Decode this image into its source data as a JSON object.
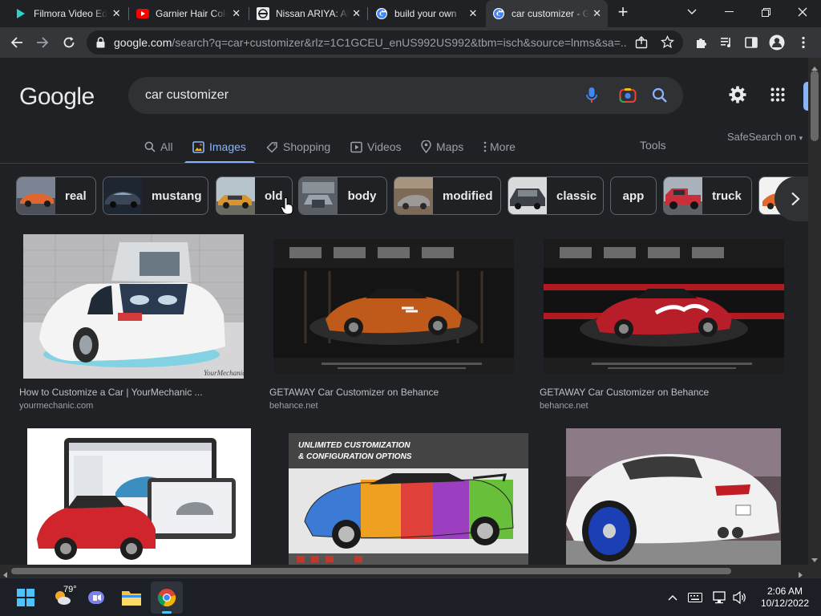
{
  "browser": {
    "tabs": [
      {
        "title": "Filmora Video Editor",
        "icon": "filmora-icon",
        "color": "#2ad4c8"
      },
      {
        "title": "Garnier Hair Color",
        "icon": "youtube-icon",
        "color": "#ff0000"
      },
      {
        "title": "Nissan ARIYA: All-Electric",
        "icon": "nissan-icon",
        "color": "#e8eaed"
      },
      {
        "title": "build your own",
        "icon": "google-icon",
        "color": "#4285f4"
      },
      {
        "title": "car customizer - Google Search",
        "icon": "google-icon",
        "color": "#4285f4"
      }
    ],
    "new_tab_label": "+",
    "close_glyph": "✕",
    "url_host": "google.com",
    "url_rest": "/search?q=car+customizer&rlz=1C1GCEU_enUS992US992&tbm=isch&source=lnms&sa=..."
  },
  "search": {
    "logo": "Google",
    "query": "car customizer",
    "nav": [
      {
        "label": "All",
        "icon": "search-icon"
      },
      {
        "label": "Images",
        "icon": "image-icon"
      },
      {
        "label": "Shopping",
        "icon": "tag-icon"
      },
      {
        "label": "Videos",
        "icon": "play-icon"
      },
      {
        "label": "Maps",
        "icon": "map-pin-icon"
      },
      {
        "label": "More",
        "icon": "more-vert-icon"
      }
    ],
    "tools": "Tools",
    "safesearch": "SafeSearch on",
    "chips": [
      {
        "label": "real",
        "color": "#c9582a"
      },
      {
        "label": "mustang",
        "color": "#2d3a48"
      },
      {
        "label": "old",
        "color": "#d6962a"
      },
      {
        "label": "body",
        "color": "#6a6f78"
      },
      {
        "label": "modified",
        "color": "#8c6d52"
      },
      {
        "label": "classic",
        "color": "#5b5f66"
      },
      {
        "label": "app",
        "color": ""
      },
      {
        "label": "truck",
        "color": "#c8323a"
      },
      {
        "label": "",
        "color": "#e06a2a"
      }
    ]
  },
  "results": [
    {
      "title": "How to Customize a Car | YourMechanic ...",
      "source": "yourmechanic.com"
    },
    {
      "title": "GETAWAY Car Customizer on Behance",
      "source": "behance.net"
    },
    {
      "title": "GETAWAY Car Customizer on Behance",
      "source": "behance.net"
    },
    {
      "title": "",
      "source": ""
    },
    {
      "title": "UNLIMITED CUSTOMIZATION & CONFIGURATION OPTIONS",
      "source": ""
    },
    {
      "title": "",
      "source": ""
    }
  ],
  "taskbar": {
    "weather_temp": "79°",
    "time": "2:06 AM",
    "date": "10/12/2022"
  }
}
